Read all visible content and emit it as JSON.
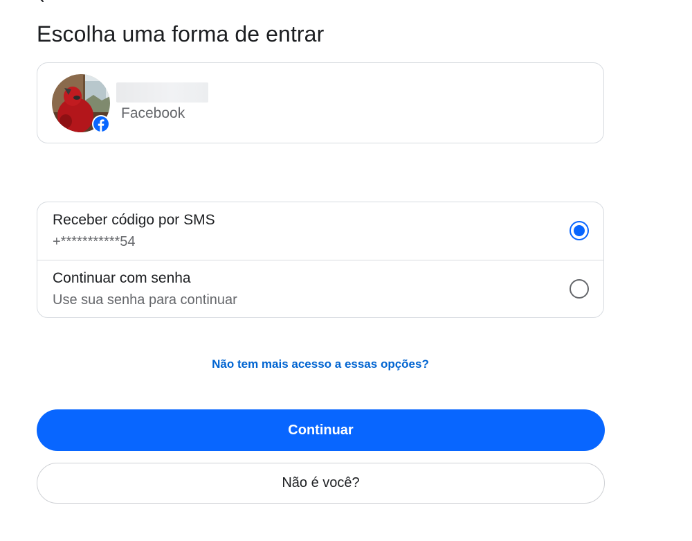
{
  "header": {
    "back_icon": "chevron-left-icon",
    "title": "Escolha uma forma de entrar"
  },
  "account": {
    "name": "",
    "platform": "Facebook",
    "badge_icon": "facebook-logo-icon"
  },
  "options": [
    {
      "title": "Receber código por SMS",
      "subtitle": "+***********54",
      "selected": true
    },
    {
      "title": "Continuar com senha",
      "subtitle": "Use sua senha para continuar",
      "selected": false
    }
  ],
  "help_link": "Não tem mais acesso a essas opções?",
  "buttons": {
    "primary": "Continuar",
    "secondary": "Não é você?"
  },
  "colors": {
    "accent": "#0866ff",
    "link": "#0064d1",
    "text": "#1c1e21",
    "muted": "#65676b",
    "border": "#d7dbe0"
  }
}
